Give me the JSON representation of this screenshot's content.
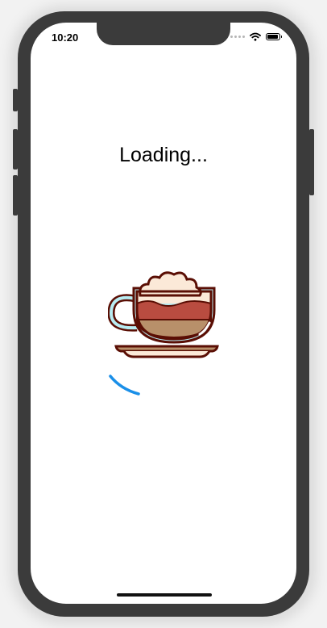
{
  "status_bar": {
    "time": "10:20",
    "icons": [
      "signal-dots-icon",
      "wifi-icon",
      "battery-icon"
    ]
  },
  "screen": {
    "title": "Loading...",
    "illustration": "coffee-cup-icon",
    "spinner": "loading-spinner"
  },
  "colors": {
    "outline": "#5a0e04",
    "foam": "#fbe9d8",
    "layer_dark": "#b94c40",
    "layer_light": "#b8906a",
    "glass": "#b8ecf2",
    "spinner": "#1a8fe8",
    "device": "#3b3b3b"
  }
}
